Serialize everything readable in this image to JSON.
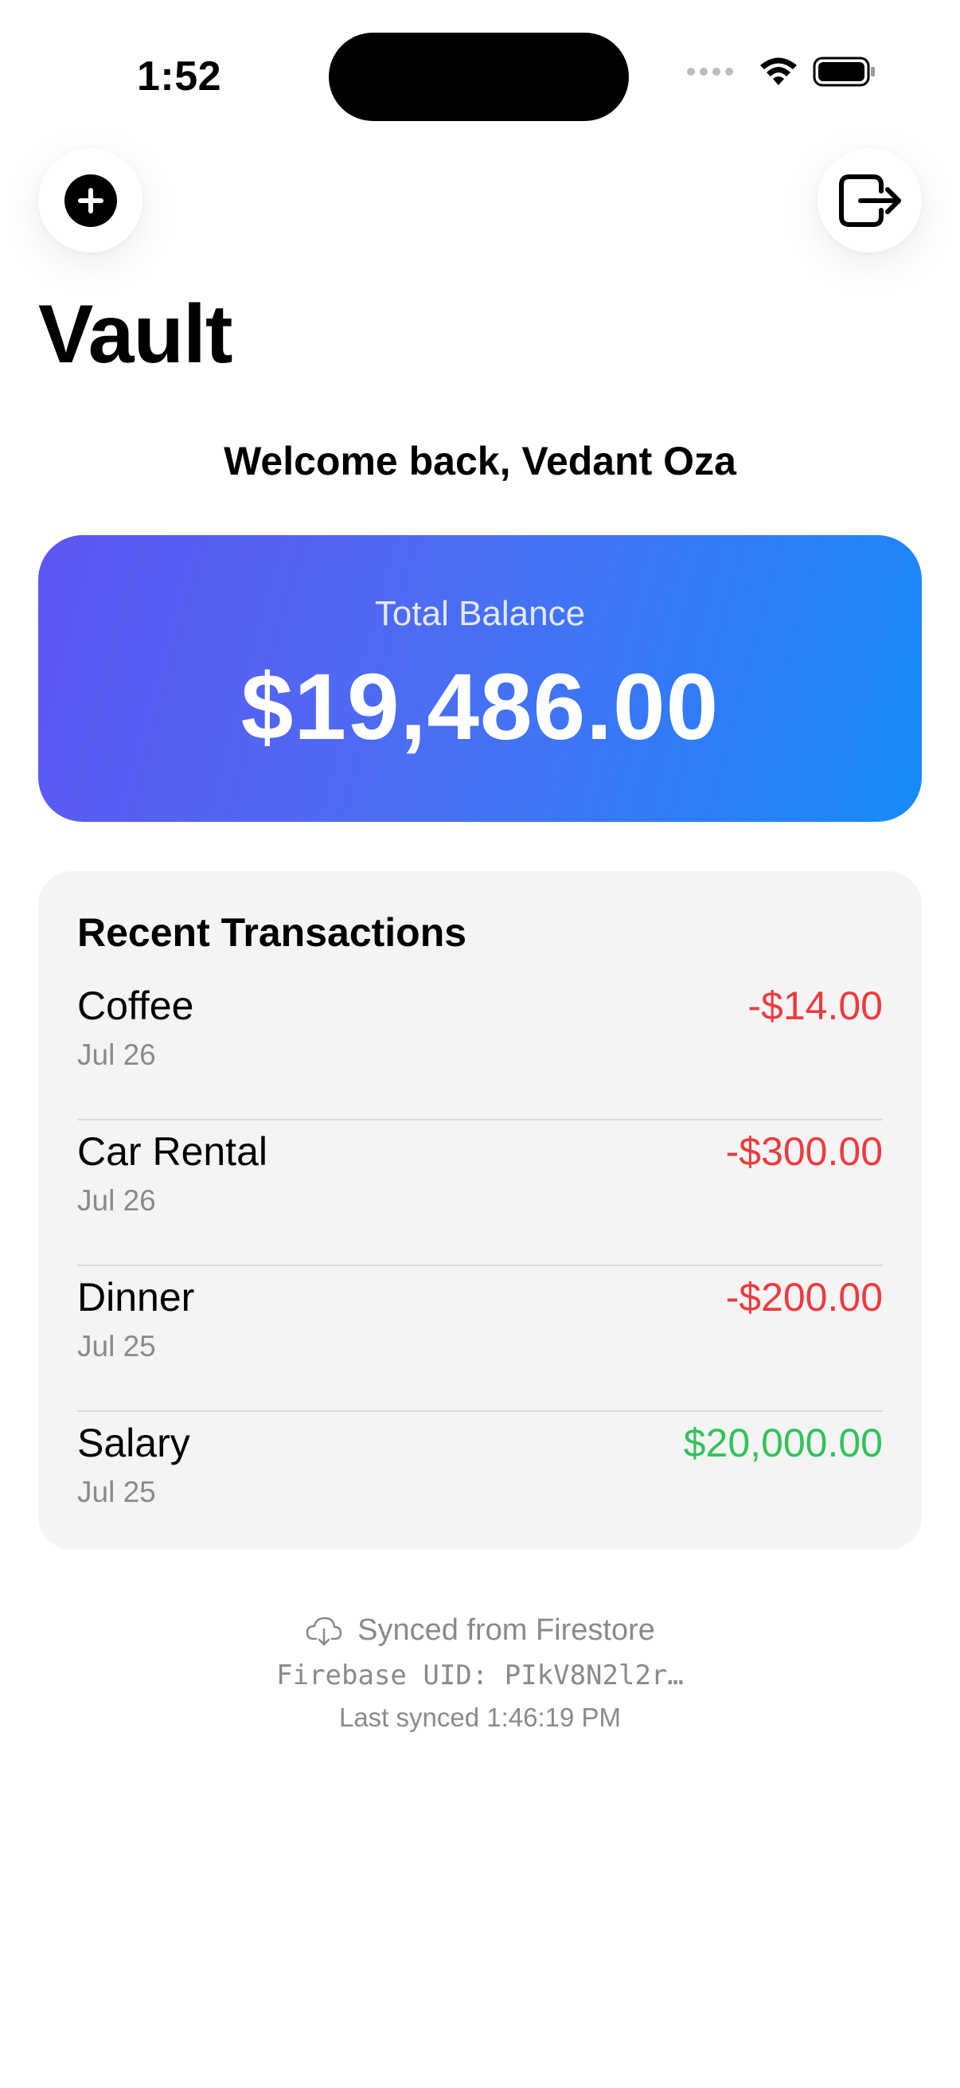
{
  "status_bar": {
    "time": "1:52",
    "icons": [
      "cellular-dots-icon",
      "wifi-icon",
      "battery-icon"
    ]
  },
  "toolbar": {
    "add_icon": "plus-circle-icon",
    "sign_out_icon": "sign-out-icon"
  },
  "header": {
    "title": "Vault"
  },
  "welcome": {
    "text": "Welcome back, Vedant Oza"
  },
  "balance": {
    "label": "Total Balance",
    "value": "$19,486.00",
    "gradient_start": "#5e56f2",
    "gradient_end": "#168af9"
  },
  "transactions": {
    "heading": "Recent Transactions",
    "items": [
      {
        "name": "Coffee",
        "date": "Jul 26",
        "amount": "-$14.00",
        "type": "debit"
      },
      {
        "name": "Car Rental",
        "date": "Jul 26",
        "amount": "-$300.00",
        "type": "debit"
      },
      {
        "name": "Dinner",
        "date": "Jul 25",
        "amount": "-$200.00",
        "type": "debit"
      },
      {
        "name": "Salary",
        "date": "Jul 25",
        "amount": "$20,000.00",
        "type": "credit"
      }
    ],
    "debit_color": "#ee3b3e",
    "credit_color": "#33c15a"
  },
  "sync": {
    "icon": "cloud-download-icon",
    "status": "Synced from Firestore",
    "uid": "Firebase UID: PIkV8N2l2r…",
    "last_synced": "Last synced 1:46:19 PM"
  }
}
